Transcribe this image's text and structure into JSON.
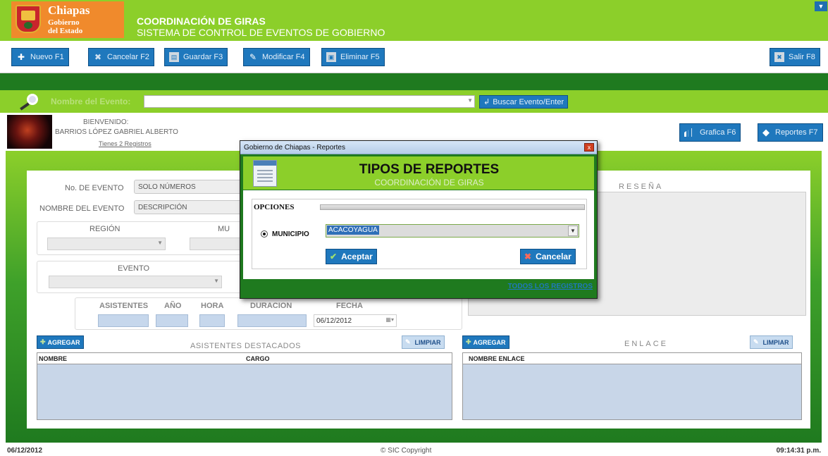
{
  "header": {
    "logo_title": "Chiapas",
    "logo_line1": "Gobierno",
    "logo_line2": "del Estado",
    "app_title": "COORDINACIÓN DE GIRAS",
    "app_subtitle": "SISTEMA DE CONTROL DE EVENTOS DE GOBIERNO"
  },
  "toolbar": {
    "nuevo": "Nuevo F1",
    "cancelar": "Cancelar F2",
    "guardar": "Guardar F3",
    "modificar": "Modificar F4",
    "eliminar": "Eliminar F5",
    "salir": "Salir F8"
  },
  "search": {
    "label": "Nombre del Evento:",
    "value": "",
    "button": "Buscar Evento/Enter"
  },
  "user": {
    "welcome": "BIENVENIDO:",
    "name": "BARRIOS LÓPEZ GABRIEL ALBERTO",
    "records": "Tienes 2 Registros"
  },
  "side_buttons": {
    "grafica": "Grafica F6",
    "reportes": "Reportes F7"
  },
  "form": {
    "no_evento_label": "No. DE EVENTO",
    "no_evento_placeholder": "SOLO NÚMEROS",
    "nombre_label": "NOMBRE DEL EVENTO",
    "nombre_placeholder": "DESCRIPCIÓN",
    "region_label": "REGIÓN",
    "municipio_label": "MU",
    "evento_label": "EVENTO",
    "asistentes_label": "ASISTENTES",
    "anio_label": "AÑO",
    "hora_label": "HORA",
    "duracion_label": "DURACION",
    "fecha_label": "FECHA",
    "fecha_value": "06/12/2012",
    "resena_label": "RESEÑA"
  },
  "asistentes": {
    "add_button": "AGREGAR",
    "title": "ASISTENTES DESTACADOS",
    "clear_button": "LIMPIAR",
    "columns": [
      "NOMBRE",
      "CARGO"
    ]
  },
  "enlace": {
    "add_button": "AGREGAR",
    "title": "ENLACE",
    "clear_button": "LIMPIAR",
    "columns": [
      "NOMBRE ENLACE"
    ]
  },
  "modal": {
    "window_title": "Gobierno de Chiapas - Reportes",
    "close": "x",
    "title": "TIPOS DE REPORTES",
    "subtitle": "COORDINACIÓN DE GIRAS",
    "options_label": "OPCIONES",
    "radio_label": "MUNICIPIO",
    "municipio_value": "ACACOYAGUA",
    "accept": "Aceptar",
    "cancel": "Cancelar",
    "all_records_link": "TODOS LOS REGISTROS"
  },
  "footer": {
    "date": "06/12/2012",
    "copyright": "© SIC Copyright",
    "time": "09:14:31 p.m."
  },
  "colors": {
    "brand_green": "#8ccf2a",
    "dark_green": "#1f7a1f",
    "button_blue": "#1f78bd",
    "logo_orange": "#f08a2c"
  }
}
